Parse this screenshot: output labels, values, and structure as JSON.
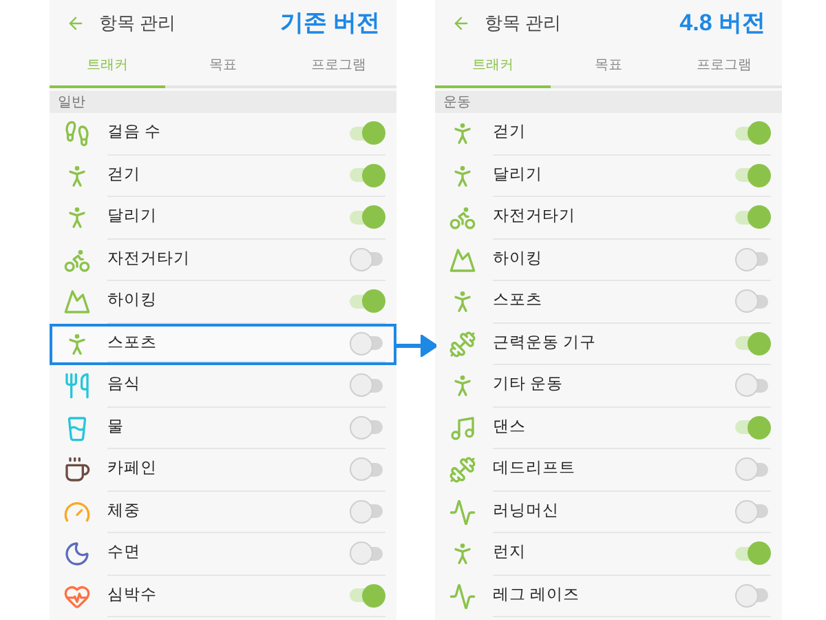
{
  "panels": [
    {
      "title": "항목 관리",
      "version": "기존 버전",
      "tabs": [
        {
          "label": "트래커",
          "selected": true
        },
        {
          "label": "목표",
          "selected": false
        },
        {
          "label": "프로그램",
          "selected": false
        }
      ],
      "section": "일반",
      "items": [
        {
          "label": "걸음 수",
          "on": true,
          "highlighted": false
        },
        {
          "label": "걷기",
          "on": true,
          "highlighted": false
        },
        {
          "label": "달리기",
          "on": true,
          "highlighted": false
        },
        {
          "label": "자전거타기",
          "on": false,
          "highlighted": false
        },
        {
          "label": "하이킹",
          "on": true,
          "highlighted": false
        },
        {
          "label": "스포츠",
          "on": false,
          "highlighted": true
        },
        {
          "label": "음식",
          "on": false,
          "highlighted": false
        },
        {
          "label": "물",
          "on": false,
          "highlighted": false
        },
        {
          "label": "카페인",
          "on": false,
          "highlighted": false
        },
        {
          "label": "체중",
          "on": false,
          "highlighted": false
        },
        {
          "label": "수면",
          "on": false,
          "highlighted": false
        },
        {
          "label": "심박수",
          "on": true,
          "highlighted": false
        }
      ]
    },
    {
      "title": "항목 관리",
      "version": "4.8 버전",
      "tabs": [
        {
          "label": "트래커",
          "selected": true
        },
        {
          "label": "목표",
          "selected": false
        },
        {
          "label": "프로그램",
          "selected": false
        }
      ],
      "section": "운동",
      "items": [
        {
          "label": "걷기",
          "on": true,
          "highlighted": false
        },
        {
          "label": "달리기",
          "on": true,
          "highlighted": false
        },
        {
          "label": "자전거타기",
          "on": true,
          "highlighted": false
        },
        {
          "label": "하이킹",
          "on": false,
          "highlighted": false
        },
        {
          "label": "스포츠",
          "on": false,
          "highlighted": false
        },
        {
          "label": "근력운동 기구",
          "on": true,
          "highlighted": false
        },
        {
          "label": "기타 운동",
          "on": false,
          "highlighted": false
        },
        {
          "label": "댄스",
          "on": true,
          "highlighted": false
        },
        {
          "label": "데드리프트",
          "on": false,
          "highlighted": false
        },
        {
          "label": "러닝머신",
          "on": false,
          "highlighted": false
        },
        {
          "label": "런지",
          "on": true,
          "highlighted": false
        },
        {
          "label": "레그 레이즈",
          "on": false,
          "highlighted": false
        }
      ]
    }
  ]
}
